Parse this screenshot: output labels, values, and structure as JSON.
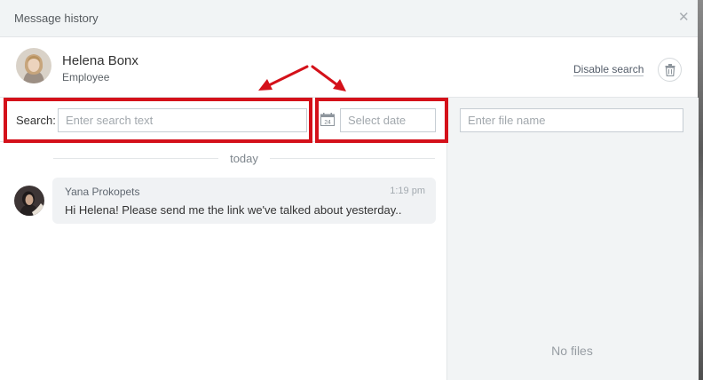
{
  "dialog": {
    "title": "Message history",
    "close_icon": "close-icon"
  },
  "user": {
    "name": "Helena Bonx",
    "role": "Employee"
  },
  "header_actions": {
    "disable_search": "Disable search",
    "trash_icon": "trash-icon"
  },
  "search": {
    "label": "Search:",
    "placeholder": "Enter search text"
  },
  "date_filter": {
    "icon": "calendar-icon",
    "calendar_day": "24",
    "placeholder": "Select date"
  },
  "files": {
    "placeholder": "Enter file name",
    "empty_text": "No files"
  },
  "messages": {
    "day_separator": "today",
    "items": [
      {
        "author": "Yana Prokopets",
        "time": "1:19 pm",
        "text": "Hi Helena! Please send me the link we've talked about yesterday.."
      }
    ]
  },
  "colors": {
    "highlight_red": "#d4111a",
    "titlebar": "#f1f4f5",
    "bubble": "#f0f2f4",
    "files_panel": "#f2f4f5"
  }
}
